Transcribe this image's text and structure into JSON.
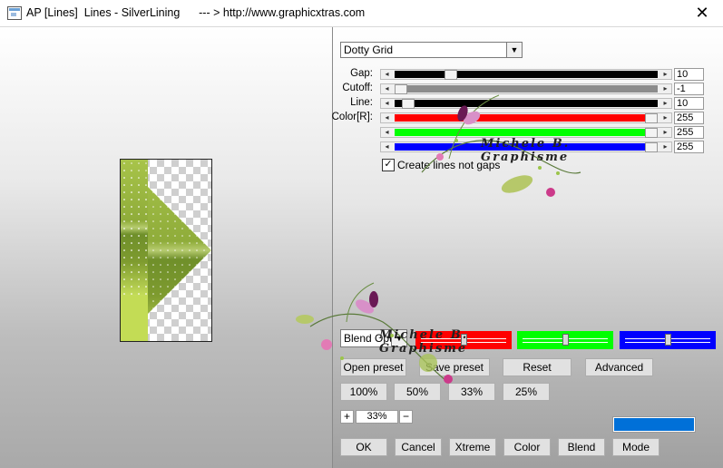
{
  "window": {
    "title": "AP [Lines]  Lines - SilverLining      --- > http://www.graphicxtras.com",
    "close_glyph": "✕"
  },
  "preset_select": {
    "value": "Dotty Grid"
  },
  "sliders": [
    {
      "label": "Gap:",
      "value": "10",
      "color": "#000000",
      "thumb_pct": 0.2
    },
    {
      "label": "Cutoff:",
      "value": "-1",
      "color": "#8c8c8c",
      "thumb_pct": 0.0
    },
    {
      "label": "Line:",
      "value": "10",
      "color": "#000000",
      "thumb_pct": 0.03
    },
    {
      "label": "Color[R]:",
      "value": "255",
      "color": "#ff0000",
      "thumb_pct": 1.0
    },
    {
      "label": "",
      "value": "255",
      "color": "#00ff00",
      "thumb_pct": 1.0
    },
    {
      "label": "",
      "value": "255",
      "color": "#0000ff",
      "thumb_pct": 1.0
    }
  ],
  "checkbox": {
    "label": "Create lines not gaps",
    "checked": true,
    "mark": "✓"
  },
  "blend_select": {
    "value": "Blend Opt"
  },
  "color_bars": [
    {
      "name": "red",
      "color": "#ff0000",
      "level": 0.5
    },
    {
      "name": "green",
      "color": "#00ff00",
      "level": 0.5
    },
    {
      "name": "blue",
      "color": "#0000ff",
      "level": 0.5
    }
  ],
  "buttons": {
    "open_preset": "Open preset",
    "save_preset": "Save preset",
    "reset": "Reset",
    "advanced": "Advanced",
    "zoom_100": "100%",
    "zoom_50": "50%",
    "zoom_33": "33%",
    "zoom_25": "25%",
    "plus": "+",
    "minus": "−",
    "ok": "OK",
    "cancel": "Cancel",
    "xtreme": "Xtreme",
    "color": "Color",
    "blend": "Blend",
    "mode": "Mode"
  },
  "zoom_value": "33%",
  "watermark_text": "Michele B. Graphisme",
  "accent_color": "#0070d8"
}
